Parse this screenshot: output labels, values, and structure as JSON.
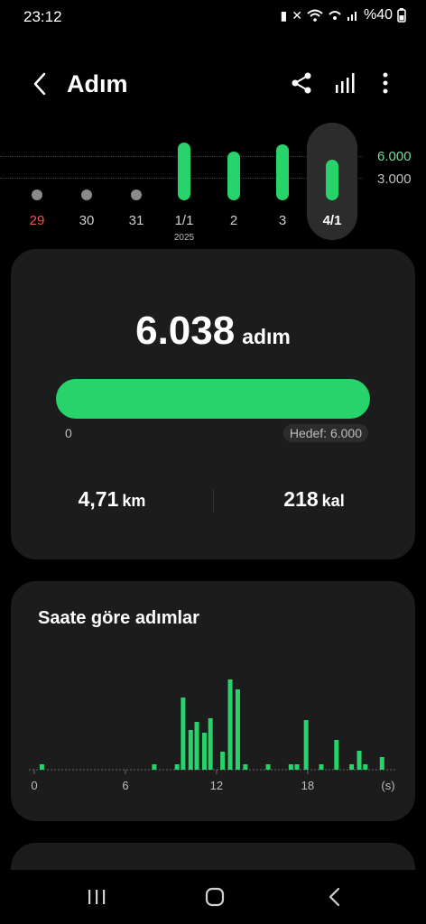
{
  "status": {
    "time": "23:12",
    "battery": "%40",
    "icons": [
      "battery-saver-icon",
      "mute-icon",
      "wifi-icon",
      "hotspot-icon",
      "signal-icon",
      "battery-icon"
    ]
  },
  "appbar": {
    "title": "Adım",
    "icons": [
      "back-arrow-icon",
      "share-icon",
      "stats-icon",
      "more-vert-icon"
    ]
  },
  "strip": {
    "labels": {
      "high": "6.000",
      "mid": "3.000"
    },
    "days": [
      {
        "label": "29",
        "sub": "",
        "value": 200,
        "color": "#8a8a8a",
        "red": true,
        "selected": false
      },
      {
        "label": "30",
        "sub": "",
        "value": 1600,
        "color": "#8a8a8a",
        "red": false,
        "selected": false
      },
      {
        "label": "31",
        "sub": "",
        "value": 900,
        "color": "#8a8a8a",
        "red": false,
        "selected": false
      },
      {
        "label": "1/1",
        "sub": "2025",
        "value": 8500,
        "color": "#27d36a",
        "red": false,
        "selected": false
      },
      {
        "label": "2",
        "sub": "",
        "value": 7200,
        "color": "#27d36a",
        "red": false,
        "selected": false
      },
      {
        "label": "3",
        "sub": "",
        "value": 8300,
        "color": "#27d36a",
        "red": false,
        "selected": false
      },
      {
        "label": "4/1",
        "sub": "",
        "value": 6038,
        "color": "#27d36a",
        "red": false,
        "selected": true
      }
    ]
  },
  "summary": {
    "steps": "6.038",
    "steps_unit": "adım",
    "progress": 1.0,
    "zero_label": "0",
    "goal_label": "Hedef: 6.000",
    "distance": "4,71",
    "distance_unit": "km",
    "calories": "218",
    "calories_unit": "kal"
  },
  "hourly": {
    "title": "Saate göre adımlar",
    "chart_data": {
      "type": "bar",
      "xlabel": "",
      "ylabel": "",
      "x_ticks": [
        "0",
        "6",
        "12",
        "18",
        "(s)"
      ],
      "x_tick_positions": [
        0,
        6,
        12,
        18,
        23.3
      ],
      "xlim": [
        0,
        23.3
      ],
      "ymax": 1000,
      "bars": [
        {
          "x": 0.5,
          "v": 40
        },
        {
          "x": 7.9,
          "v": 40
        },
        {
          "x": 9.4,
          "v": 40
        },
        {
          "x": 9.8,
          "v": 800
        },
        {
          "x": 10.3,
          "v": 440
        },
        {
          "x": 10.7,
          "v": 530
        },
        {
          "x": 11.2,
          "v": 410
        },
        {
          "x": 11.6,
          "v": 570
        },
        {
          "x": 12.4,
          "v": 200
        },
        {
          "x": 12.9,
          "v": 1000
        },
        {
          "x": 13.4,
          "v": 890
        },
        {
          "x": 13.9,
          "v": 40
        },
        {
          "x": 15.4,
          "v": 40
        },
        {
          "x": 16.9,
          "v": 40
        },
        {
          "x": 17.3,
          "v": 40
        },
        {
          "x": 17.9,
          "v": 550
        },
        {
          "x": 18.9,
          "v": 40
        },
        {
          "x": 19.9,
          "v": 330
        },
        {
          "x": 20.9,
          "v": 40
        },
        {
          "x": 21.4,
          "v": 210
        },
        {
          "x": 21.8,
          "v": 40
        },
        {
          "x": 22.9,
          "v": 140
        }
      ]
    }
  },
  "nav": {
    "icons": [
      "recents-icon",
      "home-icon",
      "nav-back-icon"
    ]
  },
  "colors": {
    "accent": "#27d36a",
    "card": "#1c1c1c",
    "inactive": "#8a8a8a",
    "weekend": "#ef5350"
  }
}
